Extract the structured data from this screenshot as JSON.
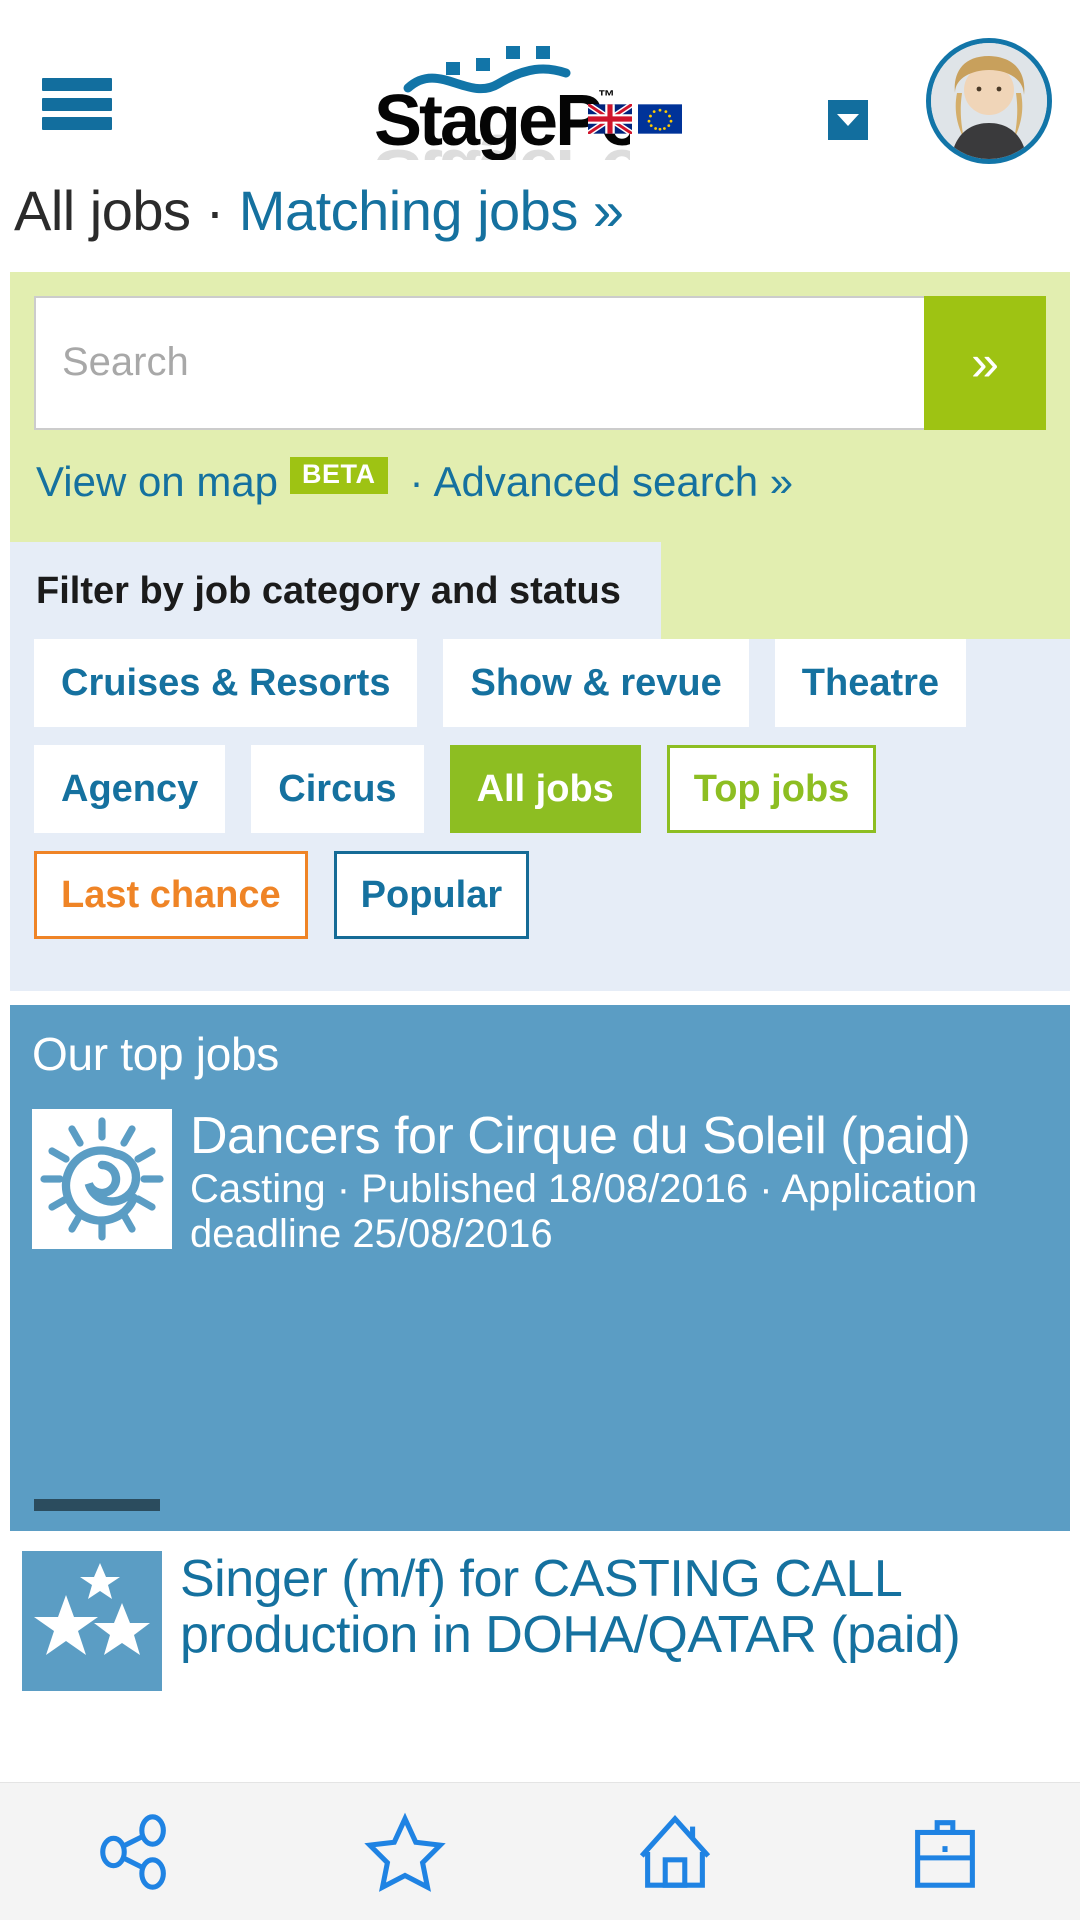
{
  "header": {
    "menu_icon": "hamburger-menu-icon",
    "logo_text": "StagePool",
    "logo_tm": "™",
    "flags": [
      {
        "name": "uk-flag-icon",
        "label": "UK"
      },
      {
        "name": "eu-flag-icon",
        "label": "EU"
      }
    ],
    "user_dropdown_icon": "chevron-down-icon",
    "avatar_alt": "user-avatar"
  },
  "breadcrumb": {
    "current": "All jobs",
    "separator": " · ",
    "link": "Matching jobs »"
  },
  "search": {
    "placeholder": "Search",
    "value": "",
    "submit_label": "»",
    "map_link": "View on map",
    "beta_badge": "BETA",
    "separator": "·",
    "advanced_link": "Advanced search »"
  },
  "filters": {
    "heading": "Filter by job category and status",
    "chips": [
      {
        "label": "Cruises & Resorts",
        "style": "plain"
      },
      {
        "label": "Show & revue",
        "style": "plain"
      },
      {
        "label": "Theatre",
        "style": "plain"
      },
      {
        "label": "Agency",
        "style": "plain"
      },
      {
        "label": "Circus",
        "style": "plain"
      },
      {
        "label": "All jobs",
        "style": "sel-green"
      },
      {
        "label": "Top jobs",
        "style": "out-green"
      },
      {
        "label": "Last chance",
        "style": "out-orange"
      },
      {
        "label": "Popular",
        "style": "out-blue"
      }
    ]
  },
  "top_jobs": {
    "section_title": "Our top jobs",
    "job": {
      "title": "Dancers for Cirque du Soleil (paid)",
      "meta": "Casting · Published 18/08/2016 · Application deadline 25/08/2016",
      "thumb_icon": "sun-spiral-icon"
    }
  },
  "lower_jobs": [
    {
      "title": "Singer (m/f) for CASTING CALL production in DOHA/QATAR (paid)",
      "thumb_icon": "stars-icon"
    }
  ],
  "bottom_nav": [
    {
      "name": "share-icon",
      "label": "Share"
    },
    {
      "name": "star-icon",
      "label": "Favourites"
    },
    {
      "name": "home-icon",
      "label": "Home"
    },
    {
      "name": "briefcase-icon",
      "label": "Jobs"
    }
  ],
  "colors": {
    "brand_blue": "#15719F",
    "accent_green": "#9ec313",
    "selected_green": "#8dbe22",
    "orange": "#ef8426",
    "panel_green": "#e2eeb0",
    "panel_blue": "#e6edf7",
    "card_blue": "#5b9dc4"
  }
}
